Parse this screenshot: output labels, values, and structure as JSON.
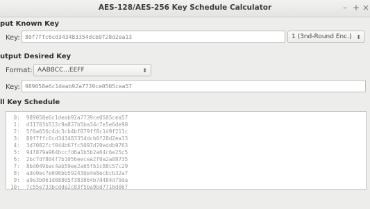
{
  "window": {
    "title": "AES-128/AES-256 Key Schedule Calculator",
    "controls": {
      "minimize": "–",
      "maximize": "+",
      "close": "×"
    }
  },
  "input_section": {
    "heading": "put Known Key",
    "key_label": "Key:",
    "key_value": "80f7ffc6cd343483354dcb0f28d2ea13",
    "round_select": "1 (3nd-Round Enc.)"
  },
  "output_section": {
    "heading": "utput Desired Key",
    "format_label": "Format:",
    "format_value": "AABBCC...EEFF",
    "key_label": "Key:",
    "key_value": "989058e6c1deab92a7739ce0505cea57"
  },
  "schedule": {
    "heading": "ll Key Schedule",
    "rows": [
      " 0:  989058e6c1deab92a7739ce0505cea57",
      " 1:  d31703b512c9a837b5ba34c7e5e6de90",
      " 2:  5f0a656c4dc3cb4bf879ff8c1d9f211c",
      " 3:  80f7ffc6cd343483354dcb0f28d2ea13",
      " 4:  3d7082fcf044b67fc5097d70eddb9763",
      " 5:  94f879a964bccfd6a1b5b2a64c6e25c5",
      " 6:  2bc7df804f7b1056eecea2f0a2a08735",
      " 7:  8bd049bac4ab59ee2a65fb1c88c57c29",
      " 8:  ado0ec7e696bb592430e4e8ecbcb32a7",
      " 9:  a9e3b061d08805f383864b7d484d79da",
      "10:  7c55e733bcdde2c03f5ba9bd7716d067"
    ]
  }
}
